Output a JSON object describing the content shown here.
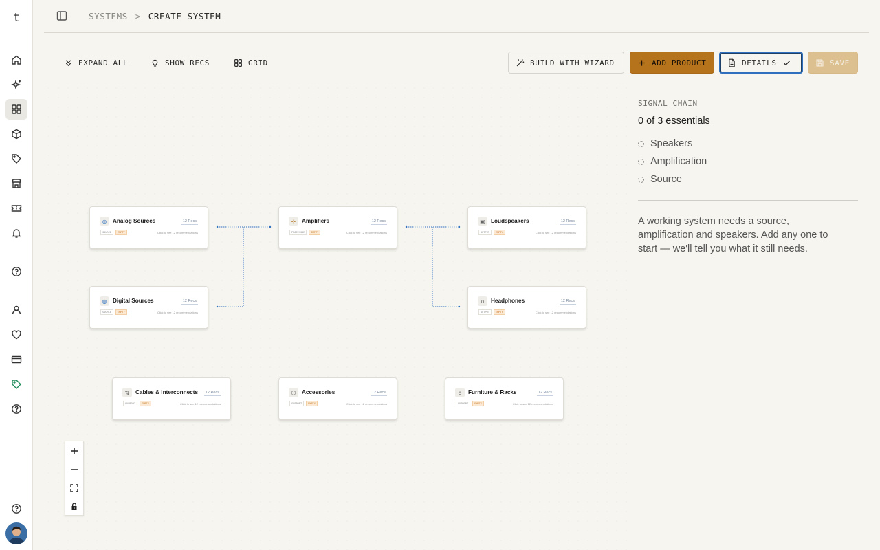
{
  "rail": {
    "logo": "t",
    "items": [
      {
        "icon": "home-icon"
      },
      {
        "icon": "sparkle-icon"
      },
      {
        "icon": "grid-icon",
        "active": true
      },
      {
        "icon": "box-icon"
      },
      {
        "icon": "tag-icon"
      },
      {
        "icon": "store-icon"
      },
      {
        "icon": "ticket-icon"
      },
      {
        "icon": "bell-icon"
      },
      {
        "icon": "help-icon"
      },
      {
        "icon": "user-icon"
      },
      {
        "icon": "heart-icon"
      },
      {
        "icon": "credit-card-icon"
      },
      {
        "icon": "tag-green-icon"
      },
      {
        "icon": "help-icon"
      },
      {
        "icon": "help-icon"
      }
    ]
  },
  "header": {
    "breadcrumb": [
      "SYSTEMS",
      "CREATE SYSTEM"
    ],
    "separator": ">"
  },
  "toolbar": {
    "expand_all": "EXPAND ALL",
    "show_recs": "SHOW RECS",
    "grid": "GRID",
    "build_with_wizard": "BUILD WITH WIZARD",
    "add_product": "ADD PRODUCT",
    "details": "DETAILS",
    "save": "SAVE"
  },
  "nodes": {
    "analog_sources": {
      "title": "Analog Sources",
      "recs": "12 Recs",
      "tag": "SOURCE",
      "status": "EMPTY",
      "hint": "Click to see 12 recommendations"
    },
    "digital_sources": {
      "title": "Digital Sources",
      "recs": "12 Recs",
      "tag": "SOURCE",
      "status": "EMPTY",
      "hint": "Click to see 12 recommendations"
    },
    "amplifiers": {
      "title": "Amplifiers",
      "recs": "12 Recs",
      "tag": "PROCESSOR",
      "status": "EMPTY",
      "hint": "Click to see 12 recommendations"
    },
    "loudspeakers": {
      "title": "Loudspeakers",
      "recs": "12 Recs",
      "tag": "OUTPUT",
      "status": "EMPTY",
      "hint": "Click to see 12 recommendations"
    },
    "headphones": {
      "title": "Headphones",
      "recs": "12 Recs",
      "tag": "OUTPUT",
      "status": "EMPTY",
      "hint": "Click to see 12 recommendations"
    },
    "cables": {
      "title": "Cables & Interconnects",
      "recs": "12 Recs",
      "tag": "SUPPORT",
      "status": "EMPTY",
      "hint": "Click to see 12 recommendations"
    },
    "accessories": {
      "title": "Accessories",
      "recs": "12 Recs",
      "tag": "SUPPORT",
      "status": "EMPTY",
      "hint": "Click to see 12 recommendations"
    },
    "furniture": {
      "title": "Furniture & Racks",
      "recs": "12 Recs",
      "tag": "SUPPORT",
      "status": "EMPTY",
      "hint": "Click to see 12 recommendations"
    }
  },
  "zoom_controls": {
    "zoom_in": "+",
    "zoom_out": "−"
  },
  "panel": {
    "eyebrow": "SIGNAL CHAIN",
    "count": "0 of 3 essentials",
    "essentials": [
      "Speakers",
      "Amplification",
      "Source"
    ],
    "note": "A working system needs a source, amplification and speakers. Add any one to start — we'll tell you what it still needs."
  },
  "colors": {
    "accent": "#b5731c",
    "selected_border": "#2f6fbe",
    "edge": "#2f6fbe",
    "background": "#f6f5f0"
  }
}
